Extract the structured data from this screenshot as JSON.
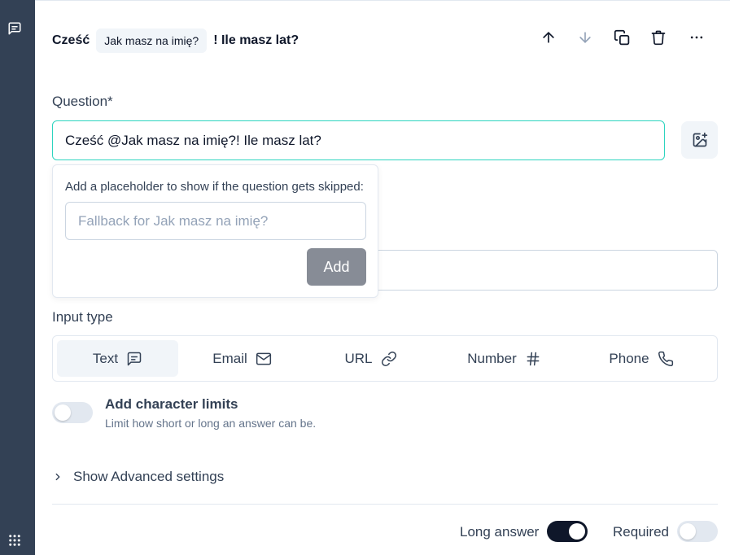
{
  "headline": {
    "prefix": "Cześć",
    "recall_chip": "Jak masz na imię?",
    "suffix": "! Ile masz lat?"
  },
  "question": {
    "label": "Question*",
    "value": "Cześć @Jak masz na imię?! Ile masz lat?"
  },
  "fallback_popover": {
    "message": "Add a placeholder to show if the question gets skipped:",
    "placeholder": "Fallback for Jak masz na imię?",
    "add_label": "Add"
  },
  "input_type": {
    "label": "Input type",
    "options": [
      {
        "label": "Text",
        "icon": "message-square-icon",
        "active": true
      },
      {
        "label": "Email",
        "icon": "mail-icon",
        "active": false
      },
      {
        "label": "URL",
        "icon": "link-icon",
        "active": false
      },
      {
        "label": "Number",
        "icon": "hash-icon",
        "active": false
      },
      {
        "label": "Phone",
        "icon": "phone-icon",
        "active": false
      }
    ]
  },
  "char_limits": {
    "title": "Add character limits",
    "description": "Limit how short or long an answer can be.",
    "enabled": false
  },
  "advanced": {
    "label": "Show Advanced settings"
  },
  "footer": {
    "long_answer_label": "Long answer",
    "long_answer_on": true,
    "required_label": "Required",
    "required_on": false
  },
  "colors": {
    "rail": "#334155",
    "focus_border": "#2dd4bf",
    "toggle_on": "#0f172a",
    "add_button": "#878c96"
  }
}
